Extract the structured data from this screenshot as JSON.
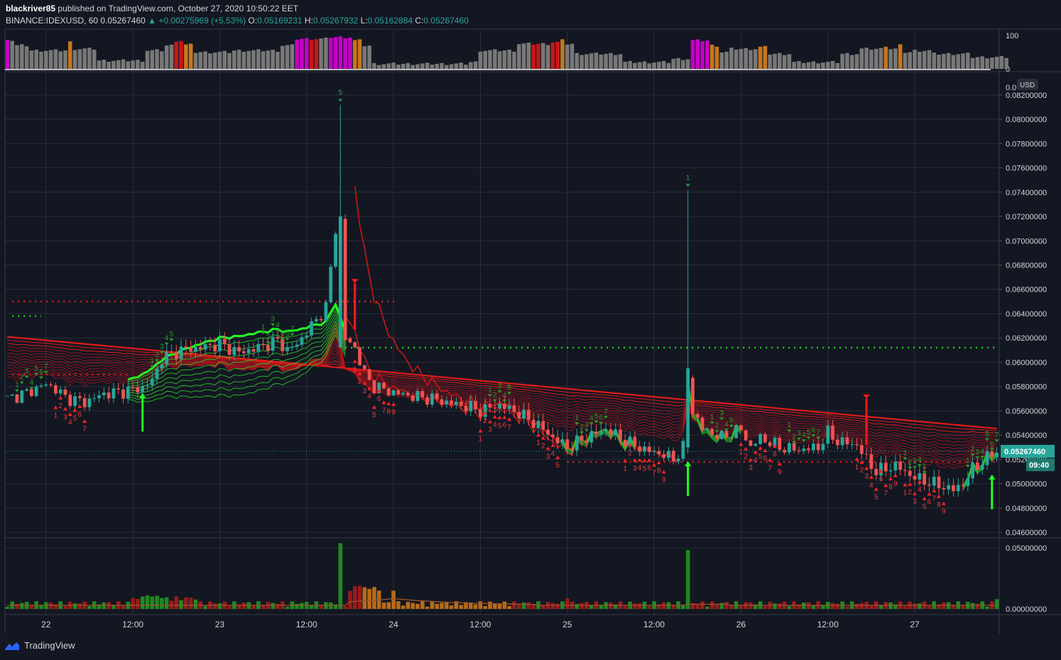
{
  "header": {
    "author": "blackriver85",
    "published_text": "published on TradingView.com, October 27, 2020 10:50:22 EET",
    "symbol": "BINANCE:IDEXUSD, 60",
    "last": "0.05267460",
    "change": "+0.00275969 (+5.53%)",
    "o_label": "O:",
    "o": "0.05169231",
    "h_label": "H:",
    "h": "0.05267932",
    "l_label": "L:",
    "l": "0.05162884",
    "c_label": "C:",
    "c": "0.05267460"
  },
  "footer": {
    "brand": "TradingView"
  },
  "colors": {
    "background": "#131722",
    "grid": "#2a2e39",
    "bull": "#26a69a",
    "bear": "#ef5350",
    "ribbon_red": "#d01818",
    "ribbon_green": "#22dd22",
    "vol_green": "#1f8a1f",
    "vol_red": "#9a1b1b",
    "vol_orange": "#b86b17",
    "osc_gray": "#787878",
    "osc_magenta": "#c400c4",
    "osc_red": "#c41818",
    "osc_orange": "#c8761c",
    "price_tag": "#26a69a"
  },
  "chart_data": [
    {
      "type": "bar",
      "name": "oscillator",
      "ylim": [
        0,
        100
      ],
      "y_ticks": [
        "100",
        "0"
      ],
      "bars": [
        {
          "start": 0,
          "count": 1,
          "value": 90,
          "color": "magenta"
        },
        {
          "start": 1,
          "count": 1,
          "value": 85,
          "color": "gray"
        },
        {
          "start": 2,
          "count": 3,
          "value": 70,
          "color": "gray"
        },
        {
          "start": 5,
          "count": 8,
          "value": 55,
          "color": "gray"
        },
        {
          "start": 13,
          "count": 1,
          "value": 80,
          "color": "orange"
        },
        {
          "start": 14,
          "count": 5,
          "value": 60,
          "color": "gray"
        },
        {
          "start": 19,
          "count": 10,
          "value": 25,
          "color": "gray"
        },
        {
          "start": 29,
          "count": 4,
          "value": 55,
          "color": "gray"
        },
        {
          "start": 33,
          "count": 2,
          "value": 70,
          "color": "gray"
        },
        {
          "start": 35,
          "count": 2,
          "value": 85,
          "color": "red"
        },
        {
          "start": 37,
          "count": 2,
          "value": 72,
          "color": "orange"
        },
        {
          "start": 39,
          "count": 8,
          "value": 50,
          "color": "gray"
        },
        {
          "start": 47,
          "count": 10,
          "value": 55,
          "color": "gray"
        },
        {
          "start": 57,
          "count": 3,
          "value": 70,
          "color": "gray"
        },
        {
          "start": 60,
          "count": 3,
          "value": 90,
          "color": "magenta"
        },
        {
          "start": 63,
          "count": 2,
          "value": 90,
          "color": "red"
        },
        {
          "start": 65,
          "count": 2,
          "value": 90,
          "color": "gray"
        },
        {
          "start": 67,
          "count": 5,
          "value": 95,
          "color": "magenta"
        },
        {
          "start": 72,
          "count": 2,
          "value": 85,
          "color": "orange"
        },
        {
          "start": 74,
          "count": 2,
          "value": 70,
          "color": "gray"
        },
        {
          "start": 76,
          "count": 20,
          "value": 15,
          "color": "gray"
        },
        {
          "start": 96,
          "count": 2,
          "value": 20,
          "color": "gray"
        },
        {
          "start": 98,
          "count": 8,
          "value": 55,
          "color": "gray"
        },
        {
          "start": 106,
          "count": 3,
          "value": 75,
          "color": "gray"
        },
        {
          "start": 109,
          "count": 2,
          "value": 75,
          "color": "red"
        },
        {
          "start": 111,
          "count": 2,
          "value": 75,
          "color": "gray"
        },
        {
          "start": 113,
          "count": 2,
          "value": 80,
          "color": "red"
        },
        {
          "start": 115,
          "count": 1,
          "value": 85,
          "color": "orange"
        },
        {
          "start": 116,
          "count": 2,
          "value": 75,
          "color": "gray"
        },
        {
          "start": 118,
          "count": 10,
          "value": 45,
          "color": "gray"
        },
        {
          "start": 128,
          "count": 10,
          "value": 20,
          "color": "gray"
        },
        {
          "start": 138,
          "count": 4,
          "value": 30,
          "color": "gray"
        },
        {
          "start": 142,
          "count": 4,
          "value": 85,
          "color": "magenta"
        },
        {
          "start": 146,
          "count": 2,
          "value": 70,
          "color": "orange"
        },
        {
          "start": 148,
          "count": 2,
          "value": 50,
          "color": "gray"
        },
        {
          "start": 150,
          "count": 6,
          "value": 60,
          "color": "gray"
        },
        {
          "start": 156,
          "count": 2,
          "value": 65,
          "color": "orange"
        },
        {
          "start": 158,
          "count": 5,
          "value": 45,
          "color": "gray"
        },
        {
          "start": 163,
          "count": 10,
          "value": 20,
          "color": "gray"
        },
        {
          "start": 173,
          "count": 4,
          "value": 45,
          "color": "gray"
        },
        {
          "start": 177,
          "count": 5,
          "value": 60,
          "color": "gray"
        },
        {
          "start": 182,
          "count": 1,
          "value": 70,
          "color": "orange"
        },
        {
          "start": 183,
          "count": 2,
          "value": 60,
          "color": "gray"
        },
        {
          "start": 185,
          "count": 1,
          "value": 70,
          "color": "orange"
        },
        {
          "start": 186,
          "count": 2,
          "value": 50,
          "color": "gray"
        },
        {
          "start": 188,
          "count": 4,
          "value": 55,
          "color": "gray"
        },
        {
          "start": 192,
          "count": 8,
          "value": 45,
          "color": "gray"
        },
        {
          "start": 200,
          "count": 8,
          "value": 35,
          "color": "gray"
        }
      ]
    },
    {
      "type": "line",
      "name": "price",
      "unit": "USD",
      "ylim": [
        0.0456,
        0.0838
      ],
      "y_ticks": [
        "0.08200000",
        "0.08000000",
        "0.07800000",
        "0.07600000",
        "0.07400000",
        "0.07200000",
        "0.07000000",
        "0.06800000",
        "0.06600000",
        "0.06400000",
        "0.06200000",
        "0.06000000",
        "0.05800000",
        "0.05600000",
        "0.05400000",
        "0.05200000",
        "0.05000000",
        "0.04800000",
        "0.04600000"
      ],
      "top_tick_label": "0.0",
      "x_ticks": [
        {
          "label": "22",
          "bar": 8
        },
        {
          "label": "12:00",
          "bar": 26
        },
        {
          "label": "23",
          "bar": 44
        },
        {
          "label": "12:00",
          "bar": 62
        },
        {
          "label": "24",
          "bar": 80
        },
        {
          "label": "12:00",
          "bar": 98
        },
        {
          "label": "25",
          "bar": 116
        },
        {
          "label": "12:00",
          "bar": 134
        },
        {
          "label": "26",
          "bar": 152
        },
        {
          "label": "12:00",
          "bar": 170
        },
        {
          "label": "27",
          "bar": 188
        }
      ],
      "bars_total": 206,
      "close_anchors": [
        [
          0,
          0.057
        ],
        [
          4,
          0.0575
        ],
        [
          8,
          0.0582
        ],
        [
          10,
          0.0578
        ],
        [
          12,
          0.0571
        ],
        [
          16,
          0.0567
        ],
        [
          20,
          0.0574
        ],
        [
          24,
          0.0576
        ],
        [
          28,
          0.0579
        ],
        [
          30,
          0.0585
        ],
        [
          32,
          0.0603
        ],
        [
          36,
          0.061
        ],
        [
          40,
          0.0612
        ],
        [
          44,
          0.0615
        ],
        [
          48,
          0.0608
        ],
        [
          52,
          0.0612
        ],
        [
          56,
          0.0618
        ],
        [
          58,
          0.061
        ],
        [
          60,
          0.0615
        ],
        [
          63,
          0.063
        ],
        [
          66,
          0.0645
        ],
        [
          68,
          0.071
        ],
        [
          70,
          0.062
        ],
        [
          72,
          0.0612
        ],
        [
          74,
          0.059
        ],
        [
          76,
          0.058
        ],
        [
          80,
          0.0575
        ],
        [
          84,
          0.0572
        ],
        [
          88,
          0.057
        ],
        [
          92,
          0.0566
        ],
        [
          96,
          0.0563
        ],
        [
          98,
          0.056
        ],
        [
          102,
          0.0565
        ],
        [
          106,
          0.0558
        ],
        [
          110,
          0.0548
        ],
        [
          113,
          0.0538
        ],
        [
          116,
          0.053
        ],
        [
          120,
          0.0538
        ],
        [
          124,
          0.0545
        ],
        [
          128,
          0.0535
        ],
        [
          132,
          0.0528
        ],
        [
          136,
          0.0524
        ],
        [
          138,
          0.052
        ],
        [
          140,
          0.053
        ],
        [
          141,
          0.0588
        ],
        [
          142,
          0.056
        ],
        [
          144,
          0.0545
        ],
        [
          148,
          0.0538
        ],
        [
          152,
          0.0545
        ],
        [
          154,
          0.053
        ],
        [
          156,
          0.0538
        ],
        [
          160,
          0.053
        ],
        [
          164,
          0.0528
        ],
        [
          168,
          0.053
        ],
        [
          170,
          0.0542
        ],
        [
          172,
          0.0535
        ],
        [
          176,
          0.0532
        ],
        [
          178,
          0.052
        ],
        [
          180,
          0.051
        ],
        [
          184,
          0.0515
        ],
        [
          188,
          0.0505
        ],
        [
          192,
          0.05
        ],
        [
          196,
          0.0495
        ],
        [
          198,
          0.05
        ],
        [
          200,
          0.0512
        ],
        [
          202,
          0.0518
        ],
        [
          205,
          0.0527
        ]
      ],
      "spikes": [
        {
          "bar": 69,
          "high": 0.0812,
          "low": 0.0615,
          "open": 0.0612,
          "close": 0.072,
          "label": "5"
        },
        {
          "bar": 70,
          "high": 0.0722,
          "low": 0.061,
          "open": 0.0718,
          "close": 0.0618
        },
        {
          "bar": 141,
          "high": 0.0742,
          "low": 0.0525,
          "open": 0.053,
          "close": 0.0595,
          "label": "1"
        }
      ],
      "ema_ribbon": {
        "red_start": 0.0616,
        "red_end_top": 0.054,
        "red_end_bottom": 0.051,
        "green_region": [
          [
            25,
            0.0578
          ],
          [
            45,
            0.0595
          ],
          [
            69,
            0.0615
          ]
        ],
        "red_fast_peak": {
          "bar": 72,
          "value": 0.0745
        }
      },
      "horizontal_dotted_levels": [
        {
          "value": 0.065,
          "from_bar": 1,
          "to_bar": 82,
          "color": "red"
        },
        {
          "value": 0.0638,
          "from_bar": 1,
          "to_bar": 8,
          "color": "green"
        },
        {
          "value": 0.0612,
          "from_bar": 70,
          "to_bar": 206,
          "color": "green"
        },
        {
          "value": 0.0518,
          "from_bar": 116,
          "to_bar": 206,
          "color": "red"
        },
        {
          "value": 0.059,
          "from_bar": 1,
          "to_bar": 26,
          "color": "red"
        }
      ],
      "signal_arrows": [
        {
          "bar": 28,
          "from": 0.0574,
          "to": 0.0543,
          "color": "green"
        },
        {
          "bar": 141,
          "from": 0.0518,
          "to": 0.049,
          "color": "green"
        },
        {
          "bar": 204,
          "from": 0.0507,
          "to": 0.0479,
          "color": "green"
        },
        {
          "bar": 72,
          "from": 0.0665,
          "to": 0.0627,
          "color": "red"
        },
        {
          "bar": 178,
          "from": 0.057,
          "to": 0.0532,
          "color": "red"
        }
      ],
      "last_price": "0.05267460",
      "countdown": "09:40"
    },
    {
      "type": "bar",
      "name": "volume",
      "ylim": [
        0,
        0.0548
      ],
      "y_ticks": [
        "0.05000000",
        "0.00000000"
      ],
      "spikes": [
        {
          "bar": 69,
          "value": 0.054,
          "color": "green"
        },
        {
          "bar": 141,
          "value": 0.0483,
          "color": "green"
        },
        {
          "bar": 71,
          "value": 0.0148,
          "color": "red"
        },
        {
          "bar": 72,
          "value": 0.0185,
          "color": "red"
        },
        {
          "bar": 73,
          "value": 0.019,
          "color": "red"
        },
        {
          "bar": 74,
          "value": 0.0178,
          "color": "orange"
        },
        {
          "bar": 75,
          "value": 0.0165,
          "color": "orange"
        },
        {
          "bar": 76,
          "value": 0.018,
          "color": "orange"
        },
        {
          "bar": 77,
          "value": 0.015,
          "color": "orange"
        },
        {
          "bar": 80,
          "value": 0.015,
          "color": "orange"
        },
        {
          "bar": 29,
          "value": 0.011,
          "color": "green"
        },
        {
          "bar": 31,
          "value": 0.0108,
          "color": "green"
        },
        {
          "bar": 33,
          "value": 0.0095,
          "color": "green"
        },
        {
          "bar": 116,
          "value": 0.0085,
          "color": "red"
        },
        {
          "bar": 205,
          "value": 0.008,
          "color": "green"
        }
      ]
    }
  ]
}
